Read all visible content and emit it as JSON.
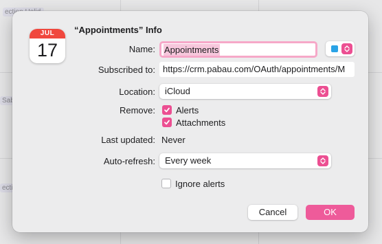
{
  "background": {
    "events": [
      "ection Holid",
      "Sabo",
      "ection"
    ]
  },
  "dialog": {
    "title": "“Appointments” Info",
    "icon": {
      "month": "JUL",
      "day": "17"
    },
    "name": {
      "label": "Name:",
      "value": "Appointments",
      "color": "#2aa3e6"
    },
    "subscribed": {
      "label": "Subscribed to:",
      "value": "https://crm.pabau.com/OAuth/appointments/M"
    },
    "location": {
      "label": "Location:",
      "value": "iCloud"
    },
    "remove": {
      "label": "Remove:",
      "alerts": {
        "label": "Alerts",
        "checked": true
      },
      "attachments": {
        "label": "Attachments",
        "checked": true
      }
    },
    "last_updated": {
      "label": "Last updated:",
      "value": "Never"
    },
    "auto_refresh": {
      "label": "Auto-refresh:",
      "value": "Every week"
    },
    "ignore_alerts": {
      "label": "Ignore alerts",
      "checked": false
    },
    "buttons": {
      "cancel": "Cancel",
      "ok": "OK"
    },
    "accent": "#ec4f92"
  }
}
